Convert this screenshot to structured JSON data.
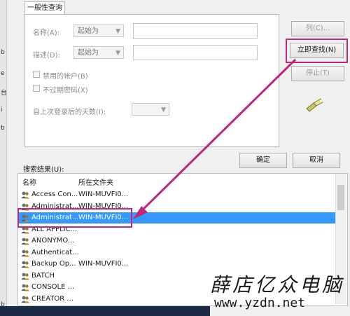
{
  "dialog": {
    "tab_label": "一般性查询",
    "name_label": "名称(A):",
    "name_mode": "起始为",
    "desc_label": "描述(D):",
    "desc_mode": "起始为",
    "disabled_accounts_label": "禁用的帐户(B)",
    "no_expire_pwd_label": "不过期密码(X)",
    "days_since_login_label": "自上次登录后的天数(I):",
    "columns_button": "列(C)...",
    "find_now_button": "立即查找(N)",
    "stop_button": "停止(T)",
    "ok_button": "确定",
    "cancel_button": "取消",
    "results_label": "搜索结果(U):"
  },
  "left_strip_chars": [
    "b",
    "e",
    "台",
    "i",
    "b",
    "b"
  ],
  "results": {
    "columns": [
      "名称",
      "所在文件夹"
    ],
    "rows": [
      {
        "name": "Access Con...",
        "folder": "WIN-MUVFI0..."
      },
      {
        "name": "Administrat...",
        "folder": "WIN-MUVFI0..."
      },
      {
        "name": "Administrat...",
        "folder": "WIN-MUVFI0...",
        "selected": true
      },
      {
        "name": "ALL APPLIC...",
        "folder": ""
      },
      {
        "name": "ANONYMO...",
        "folder": ""
      },
      {
        "name": "Authenticat...",
        "folder": ""
      },
      {
        "name": "Backup Op...",
        "folder": "WIN-MUVFI0..."
      },
      {
        "name": "BATCH",
        "folder": ""
      },
      {
        "name": "CONSOLE ...",
        "folder": ""
      },
      {
        "name": "CREATOR ...",
        "folder": ""
      }
    ]
  },
  "watermark": {
    "chinese": "薛店亿众电脑",
    "url": "www.yzdn.net"
  },
  "colors": {
    "highlight": "#c0267b",
    "selection": "#3399ff"
  }
}
